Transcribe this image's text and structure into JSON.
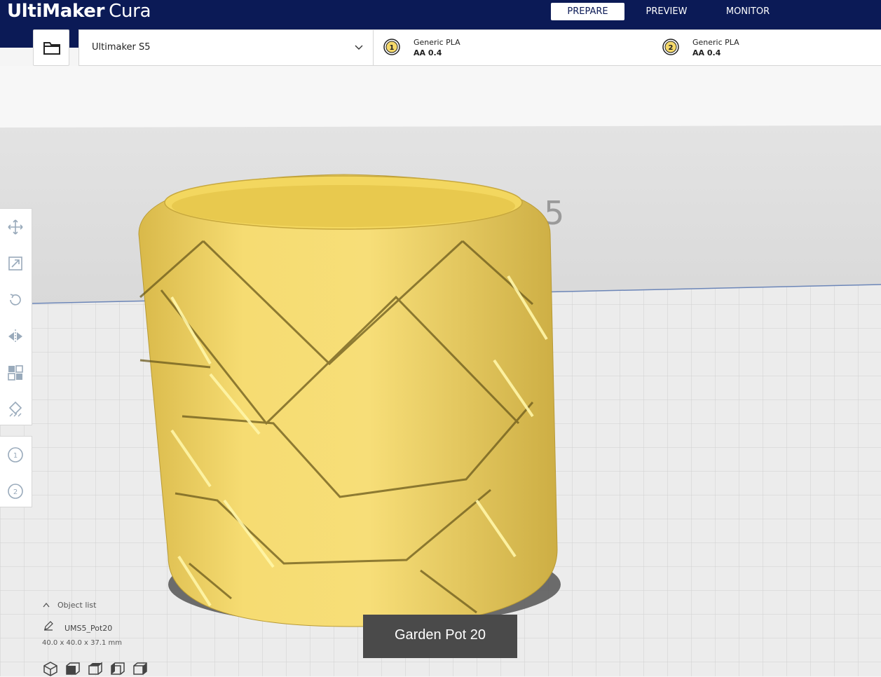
{
  "app": {
    "logo_bold": "UltiMaker",
    "logo_light": "Cura"
  },
  "nav": {
    "tabs": [
      {
        "label": "PREPARE",
        "active": true
      },
      {
        "label": "PREVIEW",
        "active": false
      },
      {
        "label": "MONITOR",
        "active": false
      }
    ]
  },
  "printer": {
    "name": "Ultimaker S5"
  },
  "extruders": [
    {
      "number": "1",
      "material": "Generic PLA",
      "nozzle": "AA 0.4"
    },
    {
      "number": "2",
      "material": "Generic PLA",
      "nozzle": "AA 0.4"
    }
  ],
  "viewport": {
    "buildplate_label": "5",
    "model_color": "#f5d96a"
  },
  "tools": [
    "move-icon",
    "scale-icon",
    "rotate-icon",
    "mirror-icon",
    "per-model-settings-icon",
    "support-blocker-icon"
  ],
  "extruder_tools": [
    "1",
    "2"
  ],
  "object_list": {
    "header": "Object list",
    "item_name": "UMS5_Pot20",
    "dimensions": "40.0 x 40.0 x 37.1 mm"
  },
  "tooltip": {
    "text": "Garden Pot 20"
  },
  "colors": {
    "header_bg": "#0b1a56",
    "accent": "#f5d96a"
  }
}
